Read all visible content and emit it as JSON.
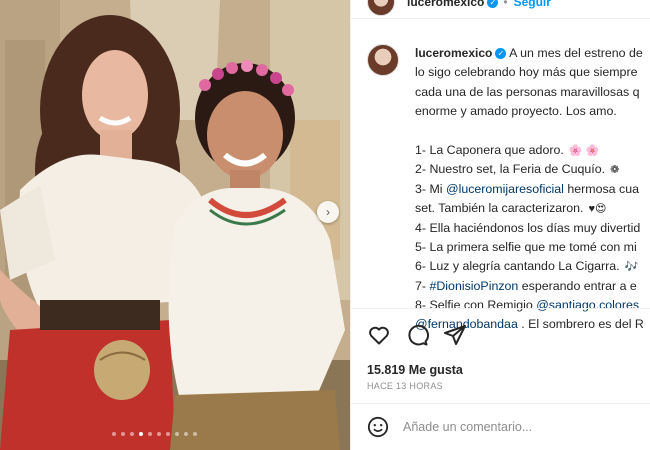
{
  "post": {
    "username": "luceromexico",
    "follow_label": "Seguir",
    "separator": "•",
    "caption_lines": [
      "A un mes del estreno de",
      "lo sigo celebrando hoy más que siempre",
      "cada una de las personas maravillosas q",
      "enorme y amado proyecto. Los amo."
    ],
    "list": [
      {
        "text": "1- La Caponera que adoro.",
        "emoji": "🌸 🌸"
      },
      {
        "text": "2- Nuestro set, la Feria de Cuquío.",
        "emoji": "❁"
      },
      {
        "prefix": "3- Mi ",
        "mention": "@luceromijaresoficial",
        "text": " hermosa cua"
      },
      {
        "text": "set. También la caracterizaron.",
        "emoji": "♥😍"
      },
      {
        "text": "4- Ella haciéndonos los días muy divertid"
      },
      {
        "text": "5- La primera selfie que me tomé con mi"
      },
      {
        "text": "6- Luz y alegría cantando La Cigarra.",
        "emoji": "🎶"
      },
      {
        "prefix": "7- ",
        "mention": "#DionisioPinzon",
        "text": " esperando entrar a e"
      },
      {
        "prefix": "8- Selfie con Remigio ",
        "mention": "@santiago.colores",
        "text": ""
      },
      {
        "prefix": "",
        "mention": "@fernandobandaa",
        "text": " . El sombrero es del R"
      }
    ],
    "likes": "15.819 Me gusta",
    "time": "HACE 13 HORAS",
    "comment_placeholder": "Añade un comentario...",
    "carousel_count": 10,
    "carousel_active": 3
  },
  "icons": [
    "heart-icon",
    "comment-icon",
    "share-icon",
    "emoji-icon",
    "chevron-right-icon",
    "verified-icon"
  ],
  "colors": {
    "link": "#00376b",
    "accent": "#0095f6",
    "text": "#262626",
    "muted": "#8e8e8e"
  }
}
